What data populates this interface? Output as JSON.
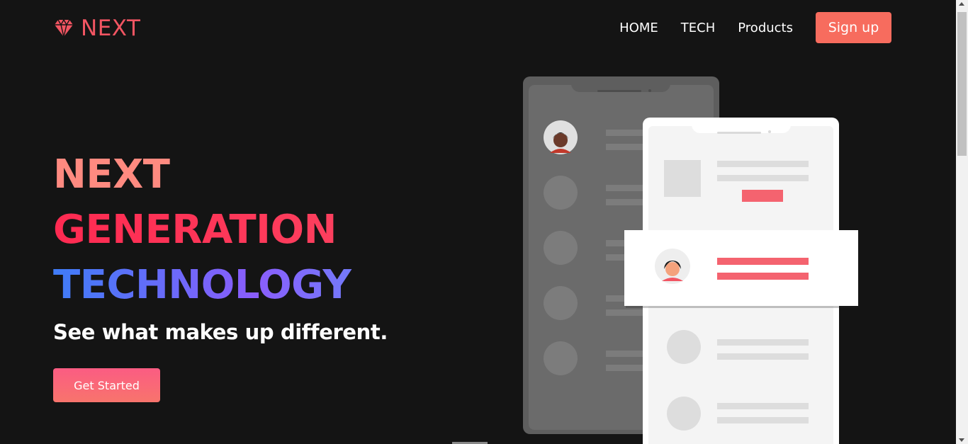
{
  "brand": {
    "name": "NEXT",
    "icon": "diamond-icon",
    "color": "#f25562"
  },
  "nav": {
    "items": [
      {
        "label": "HOME"
      },
      {
        "label": "TECH"
      },
      {
        "label": "Products"
      }
    ],
    "signup_label": "Sign up"
  },
  "hero": {
    "line1": "NEXT",
    "line2": "GENERATION",
    "line3": "TECHNOLOGY",
    "subtitle": "See what makes up different.",
    "cta_label": "Get Started"
  },
  "colors": {
    "background": "#141414",
    "accent": "#f76c5e",
    "heading_pink": "#fe8a80",
    "heading_red": "#fe2a51",
    "heading_blue": "#3f7cf7",
    "heading_purple": "#8a5dfb"
  }
}
